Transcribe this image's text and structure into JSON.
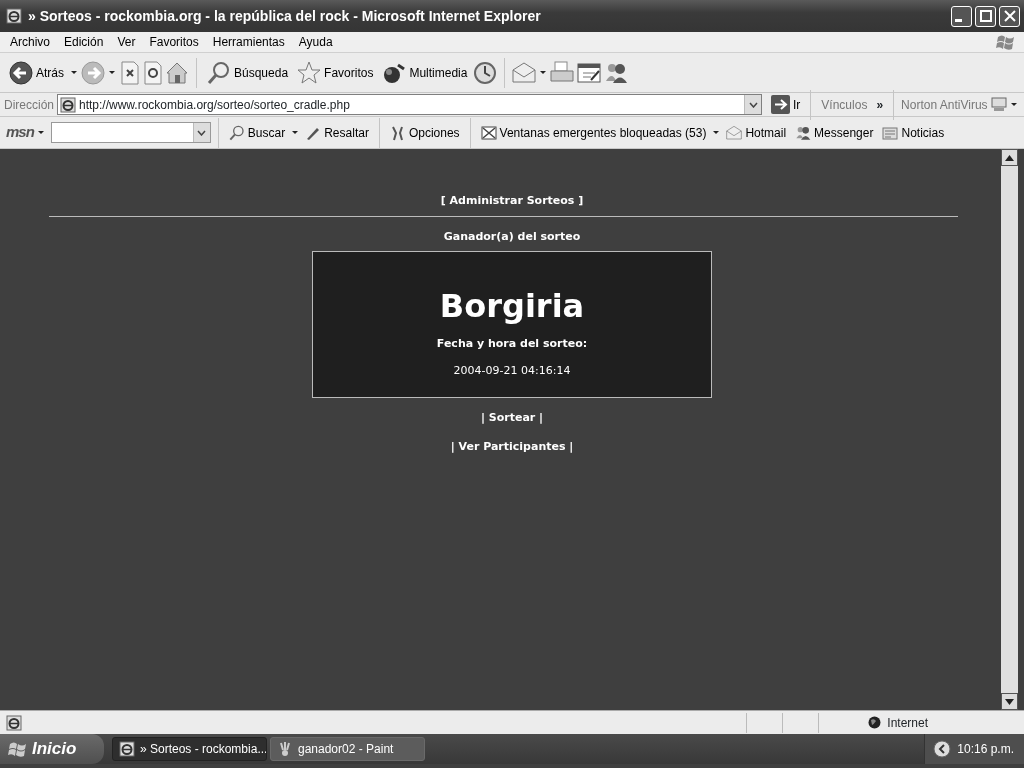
{
  "window": {
    "title": "» Sorteos - rockombia.org - la república del rock - Microsoft Internet Explorer"
  },
  "menu": [
    "Archivo",
    "Edición",
    "Ver",
    "Favoritos",
    "Herramientas",
    "Ayuda"
  ],
  "toolbar": [
    {
      "label": "Atrás"
    },
    {
      "label": "Búsqueda"
    },
    {
      "label": "Favoritos"
    },
    {
      "label": "Multimedia"
    }
  ],
  "address": {
    "label": "Dirección",
    "url": "http://www.rockombia.org/sorteo/sorteo_cradle.php",
    "go": "Ir",
    "links": "Vínculos",
    "links_more": "»",
    "norton": "Norton AntiVirus"
  },
  "msn_toolbar": {
    "logo": "msn",
    "items": [
      {
        "label": "Buscar"
      },
      {
        "label": "Resaltar"
      },
      {
        "label": "Opciones"
      },
      {
        "label": "Ventanas emergentes bloqueadas (53)"
      },
      {
        "label": "Hotmail"
      },
      {
        "label": "Messenger"
      },
      {
        "label": "Noticias"
      }
    ]
  },
  "page": {
    "admin_link": "[ Administrar Sorteos ]",
    "heading": "Ganador(a) del sorteo",
    "winner": "Borgiria",
    "date_label": "Fecha y hora del sorteo:",
    "date": "2004-09-21 04:16:14",
    "links": [
      "| Sortear |",
      "| Ver Participantes |"
    ]
  },
  "status_bar": {
    "zone": "Internet"
  },
  "taskbar": {
    "start": "Inicio",
    "tasks": [
      {
        "label": "» Sorteos - rockombia...",
        "selected": true
      },
      {
        "label": "ganador02 - Paint",
        "selected": false
      }
    ],
    "clock": "10:16 p.m."
  }
}
